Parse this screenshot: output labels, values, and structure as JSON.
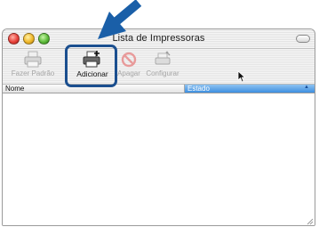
{
  "window": {
    "title": "Lista de Impressoras"
  },
  "toolbar": {
    "items": [
      {
        "label": "Fazer Padrão",
        "icon": "printer-default-icon",
        "enabled": false
      },
      {
        "label": "Adicionar",
        "icon": "printer-add-icon",
        "enabled": true
      },
      {
        "label": "Apagar",
        "icon": "delete-icon",
        "enabled": false
      },
      {
        "label": "Configurar",
        "icon": "configure-icon",
        "enabled": false
      }
    ]
  },
  "list": {
    "columns": [
      "Nome",
      "Estado"
    ],
    "sort_indicator": "▲",
    "rows": []
  },
  "colors": {
    "highlight": "#1b4f8f",
    "arrow": "#1a5fa8",
    "selected_column": "#3d8fe0"
  }
}
